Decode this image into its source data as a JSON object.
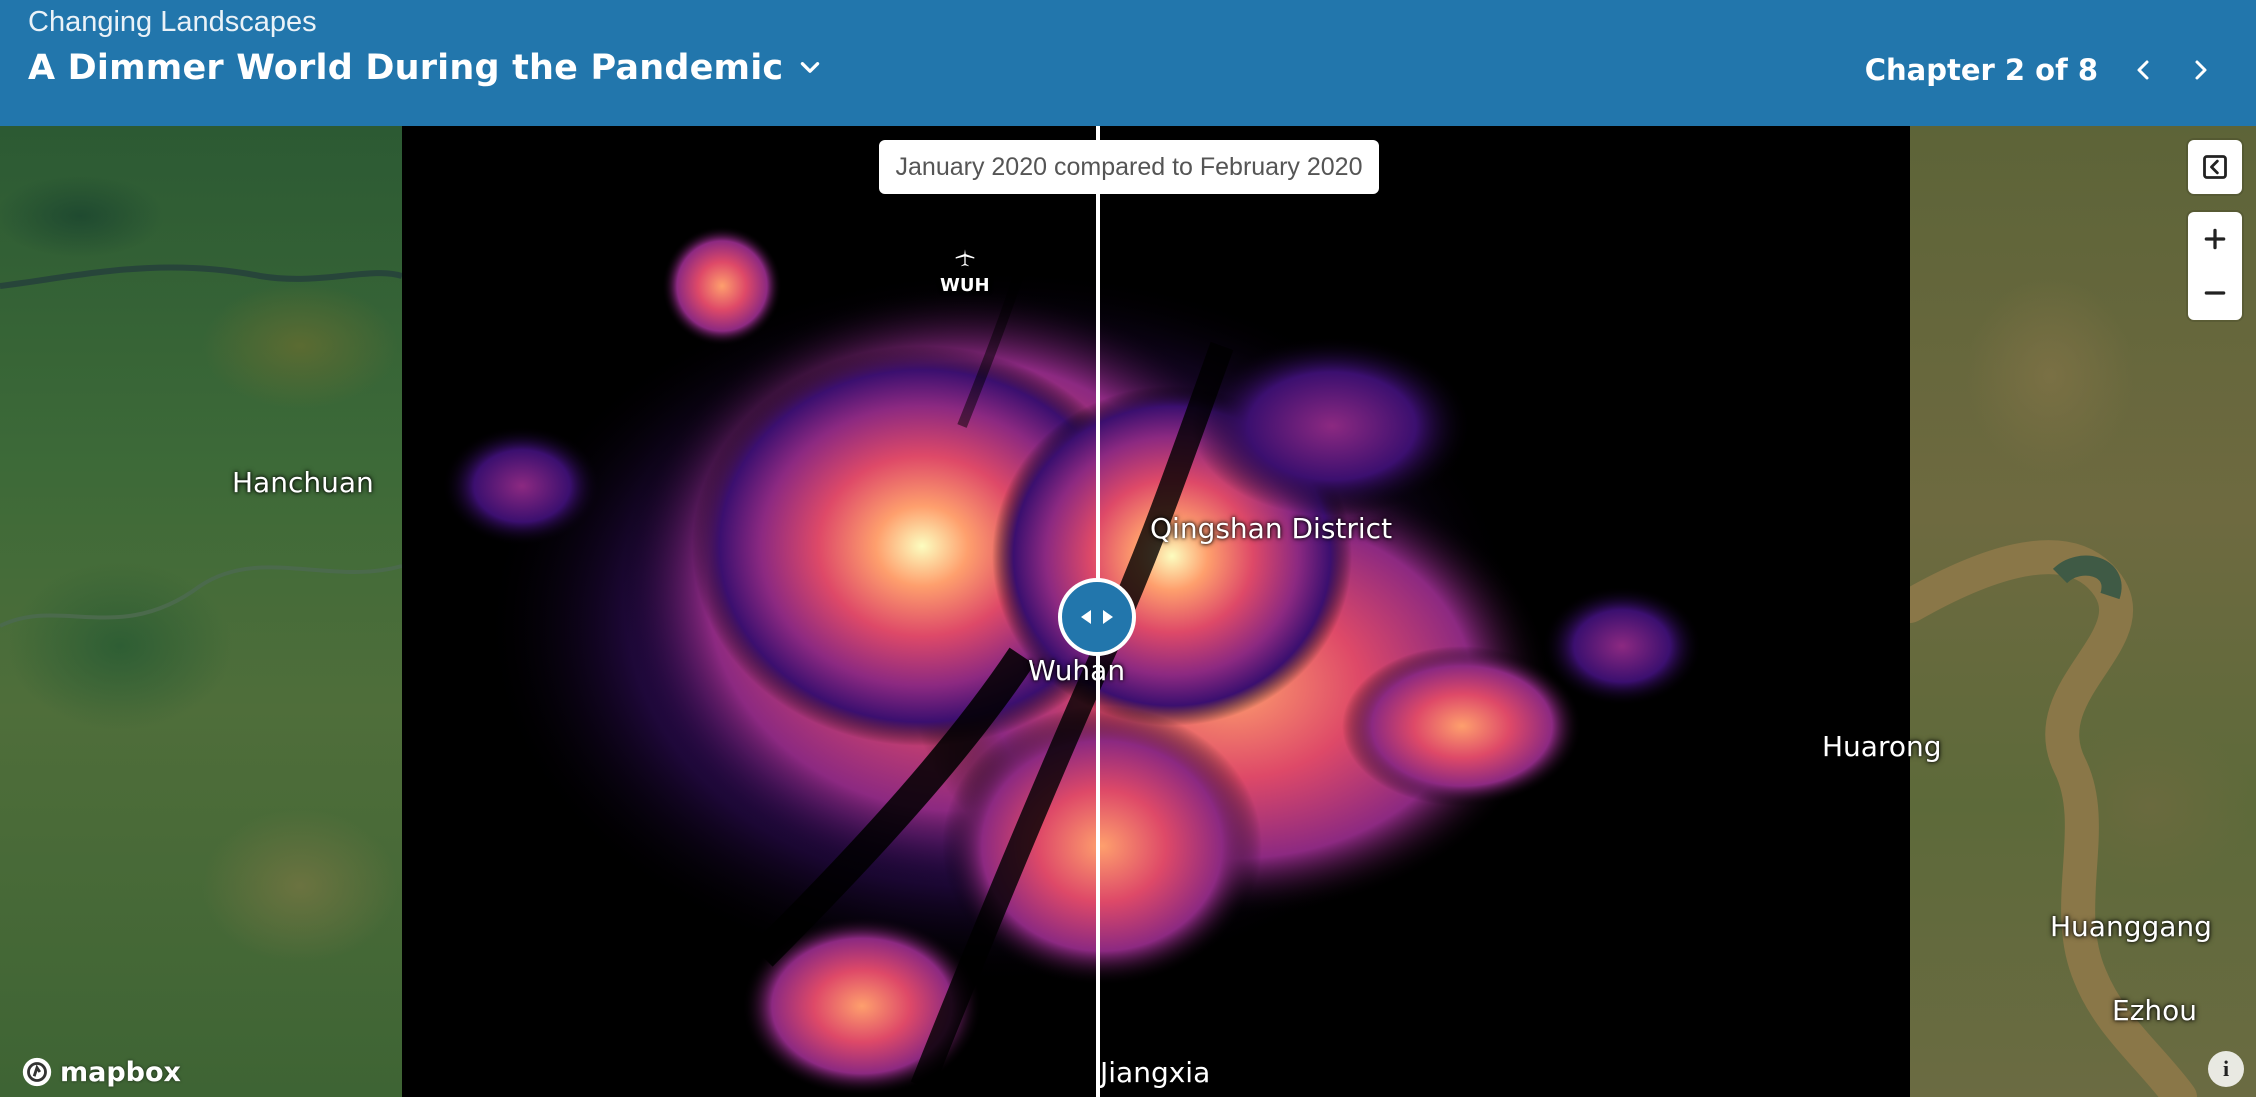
{
  "header": {
    "eyebrow": "Changing Landscapes",
    "title": "A Dimmer World During the Pandemic",
    "chapter": "Chapter 2 of 8",
    "bg_color": "#2276ac"
  },
  "map": {
    "compare_label": "January 2020 compared to February 2020",
    "places": {
      "hanchuan": "Hanchuan",
      "qingshan": "Qingshan District",
      "wuhan": "Wuhan",
      "huarong": "Huarong",
      "huanggang": "Huanggang",
      "ezhou": "Ezhou",
      "jiangxia": "Jiangxia"
    },
    "airport_code": "WUH",
    "attribution": "mapbox",
    "controls": {
      "collapse": "collapse-icon",
      "zoom_in": "plus-icon",
      "zoom_out": "minus-icon",
      "info": "info-icon"
    },
    "palette": [
      "#000000",
      "#3b0f6f",
      "#8c2981",
      "#de4968",
      "#fe9f6d",
      "#fcfdbf"
    ]
  }
}
